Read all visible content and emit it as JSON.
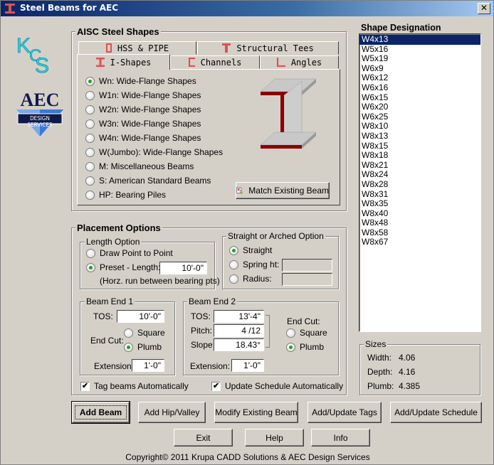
{
  "window": {
    "title": "Steel Beams for AEC",
    "close_label": "✕"
  },
  "logos": {
    "kcs": "KCS",
    "aec_top": "AEC",
    "aec_bottom": "DESIGN SERVICES"
  },
  "shapes_group": {
    "title": "AISC Steel Shapes",
    "tabs": [
      {
        "label": "HSS & PIPE",
        "icon": "hss-icon"
      },
      {
        "label": "Structural Tees",
        "icon": "tee-icon"
      },
      {
        "label": "I-Shapes",
        "icon": "i-shape-icon",
        "active": true
      },
      {
        "label": "Channels",
        "icon": "channel-icon"
      },
      {
        "label": "Angles",
        "icon": "angle-icon"
      }
    ],
    "radios": [
      {
        "label": "Wn: Wide-Flange Shapes",
        "checked": true
      },
      {
        "label": "W1n: Wide-Flange Shapes",
        "checked": false
      },
      {
        "label": "W2n: Wide-Flange Shapes",
        "checked": false
      },
      {
        "label": "W3n: Wide-Flange Shapes",
        "checked": false
      },
      {
        "label": "W4n: Wide-Flange Shapes",
        "checked": false
      },
      {
        "label": "W(Jumbo): Wide-Flange Shapes",
        "checked": false
      },
      {
        "label": "M: Miscellaneous Beams",
        "checked": false
      },
      {
        "label": "S: American Standard Beams",
        "checked": false
      },
      {
        "label": "HP: Bearing Piles",
        "checked": false
      }
    ],
    "match_button": "Match Existing Beam"
  },
  "shape_designation": {
    "title": "Shape Designation",
    "items": [
      "W4x13",
      "W5x16",
      "W5x19",
      "W6x9",
      "W6x12",
      "W6x16",
      "W6x15",
      "W6x20",
      "W6x25",
      "W8x10",
      "W8x13",
      "W8x15",
      "W8x18",
      "W8x21",
      "W8x24",
      "W8x28",
      "W8x31",
      "W8x35",
      "W8x40",
      "W8x48",
      "W8x58",
      "W8x67"
    ],
    "selected": "W4x13"
  },
  "placement": {
    "title": "Placement Options",
    "length_option": {
      "title": "Length Option",
      "draw_label": "Draw Point to Point",
      "preset_label": "Preset - Length:",
      "preset_value": "10'-0\"",
      "note": "(Horz. run  between bearing pts)",
      "selected": "preset"
    },
    "arched_option": {
      "title": "Straight or Arched Option",
      "straight_label": "Straight",
      "spring_label": "Spring ht:",
      "radius_label": "Radius:",
      "spring_value": "",
      "radius_value": "",
      "selected": "straight"
    },
    "end1": {
      "title": "Beam End 1",
      "tos_label": "TOS:",
      "tos_value": "10'-0\"",
      "endcut_label": "End Cut:",
      "square_label": "Square",
      "plumb_label": "Plumb",
      "selected": "plumb",
      "extension_label": "Extension:",
      "extension_value": "1'-0\""
    },
    "end2": {
      "title": "Beam End 2",
      "tos_label": "TOS:",
      "tos_value": "13'-4\"",
      "pitch_label": "Pitch:",
      "pitch_value": "4 /12",
      "slope_label": "Slope:",
      "slope_value": "18.43°",
      "endcut_label": "End Cut:",
      "square_label": "Square",
      "plumb_label": "Plumb",
      "selected": "plumb",
      "extension_label": "Extension:",
      "extension_value": "1'-0\""
    },
    "tag_auto": {
      "label": "Tag beams Automatically",
      "checked": true
    },
    "schedule_auto": {
      "label": "Update Schedule Automatically",
      "checked": true
    }
  },
  "sizes": {
    "title": "Sizes",
    "width_label": "Width:",
    "width_value": "4.06",
    "depth_label": "Depth:",
    "depth_value": "4.16",
    "plumb_label": "Plumb:",
    "plumb_value": "4.385"
  },
  "buttons": {
    "add_beam": "Add Beam",
    "add_hip": "Add Hip/Valley",
    "modify": "Modify Existing Beam",
    "tags": "Add/Update Tags",
    "schedule": "Add/Update Schedule",
    "exit": "Exit",
    "help": "Help",
    "info": "Info"
  },
  "copyright": "Copyright© 2011  Krupa CADD Solutions & AEC Design Services",
  "colors": {
    "accent_red": "#e05050",
    "title_blue": "#0a246a",
    "kcs_cyan": "#1ed6e6",
    "aec_navy": "#0f1a4a"
  }
}
